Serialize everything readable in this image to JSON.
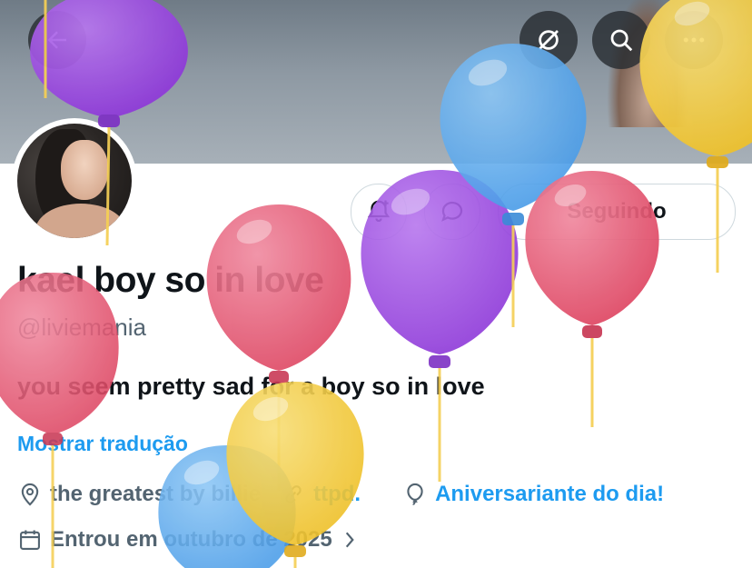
{
  "header": {
    "back_icon": "arrow-left-icon",
    "grok_icon": "grok-icon",
    "search_icon": "search-icon",
    "more_icon": "more-horizontal-icon"
  },
  "profile": {
    "name": "kael boy so in love",
    "handle": "@liviemania",
    "bio": "you seem pretty sad for a boy so in love",
    "translate_label": "Mostrar tradução",
    "follow_state_label": "Seguindo",
    "location": "the greatest by billie",
    "website": "ttpd.",
    "birthday_label": "Aniversariante do dia!",
    "joined": "Entrou em outubro de 2025"
  },
  "colors": {
    "accent": "#1d9bf0",
    "balloon_pink": "#e4546f",
    "balloon_purple": "#9a47e0",
    "balloon_blue": "#56a7ec",
    "balloon_yellow": "#f2cd3c"
  }
}
